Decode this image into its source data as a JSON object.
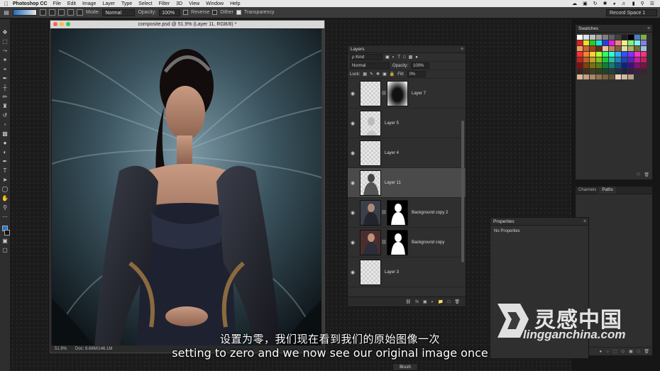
{
  "menubar": {
    "app_name": "Photoshop CC",
    "items": [
      "File",
      "Edit",
      "Image",
      "Layer",
      "Type",
      "Select",
      "Filter",
      "3D",
      "View",
      "Window",
      "Help"
    ]
  },
  "options": {
    "mode_label": "Mode:",
    "mode_value": "Normal",
    "opacity_label": "Opacity:",
    "opacity_value": "100%",
    "reverse_label": "Reverse",
    "dither_label": "Dither",
    "transparency_label": "Transparency",
    "workspace": "Record Space 1"
  },
  "document": {
    "title": "composite.psd @ 51.9% (Layer 11, RGB/8) *",
    "zoom": "51.9%",
    "doc_size": "Doc: 8.68M/146.1M"
  },
  "layers": {
    "title": "Layers",
    "kind_label": "ρ Kind",
    "blend_mode": "Normal",
    "opacity_label": "Opacity:",
    "opacity_value": "100%",
    "lock_label": "Lock:",
    "fill_label": "Fill:",
    "fill_value": "0%",
    "items": [
      {
        "name": "Layer 7"
      },
      {
        "name": "Layer 5"
      },
      {
        "name": "Layer 4"
      },
      {
        "name": "Layer 11"
      },
      {
        "name": "Background copy 2"
      },
      {
        "name": "Background copy"
      },
      {
        "name": "Layer 3"
      }
    ]
  },
  "swatches": {
    "title": "Swatches"
  },
  "channels_paths": {
    "tab_channels": "Channels",
    "tab_paths": "Paths"
  },
  "properties": {
    "title": "Properties",
    "empty_text": "No Properties"
  },
  "brush": {
    "label": "Brush"
  },
  "subtitles": {
    "zh": "设置为零，我们现在看到我们的原始图像一次",
    "en": "setting to zero and we now see our original image once"
  },
  "watermark": {
    "cn": "灵感中国",
    "en": "lingganchina.com"
  },
  "colors": {
    "foreground": "#1c78d6",
    "background": "#111111",
    "accent": "#4a4a4a"
  }
}
